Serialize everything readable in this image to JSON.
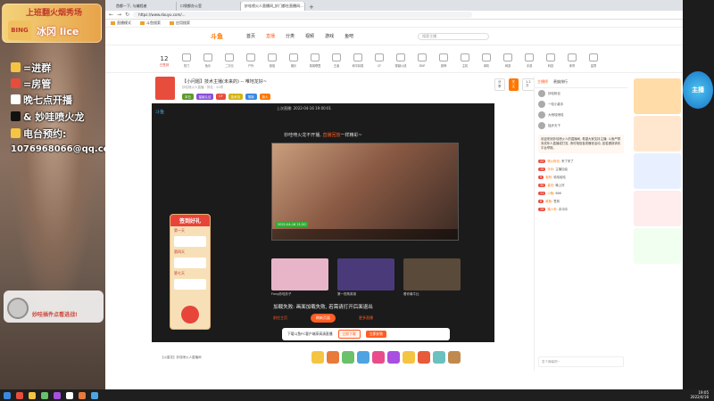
{
  "overlay": {
    "badge_title": "上班翻火烟秀场",
    "badge_name": "冰冈 lice",
    "badge_avatar": "BING",
    "lines": [
      "=进群",
      "=房管",
      "晚七点开播",
      "& 妙哇喷火龙",
      "电台预约:",
      "1076968066@qq.com"
    ],
    "bottom_text": "妙哇插件点看进战!"
  },
  "browser": {
    "tabs": [
      "首都—下, 与编程者",
      "口袋都办公室",
      "妙哇喷火人直播间_妙门都在直播间..."
    ],
    "url": "https://www.douyu.com/...",
    "bookmarks": [
      "直播模式",
      "斗鱼搜索",
      "应用搜索"
    ]
  },
  "site": {
    "logo": "斗鱼",
    "nav": [
      "首页",
      "直播",
      "分类",
      "视频",
      "游戏",
      "鱼吧"
    ],
    "search_placeholder": "搜索主播",
    "day_num": "12",
    "day_label": "已签到",
    "categories": [
      "热门",
      "鱼乐",
      "二次元",
      "户外",
      "颜值",
      "娱乐",
      "英雄联盟",
      "王者",
      "和平精英",
      "CF",
      "穿越火线",
      "DNF",
      "原神",
      "主机",
      "单机",
      "网游",
      "手游",
      "科技",
      "体育",
      "星秀"
    ]
  },
  "room": {
    "title": "【小问题】技术主播(未来的) -- 唯地龙好~",
    "sub": "妙哇喷火人直播 · 排名 · 20项",
    "tags": [
      "本日",
      "星级认证",
      "CF",
      "技术流",
      "带妹",
      "新人"
    ],
    "tag_colors": [
      "#5c9a2c",
      "#8a4fd8",
      "#e84c3d",
      "#d2b40f",
      "#3a88e0",
      "#ff7700"
    ],
    "btn_share": "分享",
    "btn_follow": "关注",
    "follow_count": "1.2万"
  },
  "player": {
    "top": "上次直播: 2022-04-16 19:00:01",
    "logo_text": "斗鱼",
    "tip_before": "妙哇喷火龙不开播, ",
    "tip_em": "直播回放",
    "tip_after": "一样精彩~",
    "video_date": "2022-04-16 21:20",
    "thumbs": [
      "Fong妙哇妙子",
      "第一视角英雄",
      "看你最牛比"
    ],
    "thumb_colors": [
      "#e8b4c8",
      "#4a3a7a",
      "#5a4a3a"
    ],
    "load_text": "加载失败: 画面加载失败, 若需请打开后面退出",
    "btn_home": "前往主页",
    "btn_reload": "刷新页面",
    "btn_other": "更多直播",
    "dl_text": "下载斗鱼PC客户端享高清直播",
    "dl_btn1": "立即下载",
    "dl_btn2": "立即安装"
  },
  "checkin": {
    "title": "签到好礼",
    "days": [
      "第一天",
      "第四天",
      "第七天"
    ]
  },
  "giftbar": {
    "label": "【火星花】妙哇喷火人直播间",
    "colors": [
      "#f4c542",
      "#e87a3a",
      "#6bc06b",
      "#4fa3e0",
      "#e84c8a",
      "#a84fe0",
      "#f4c542",
      "#e85a3a",
      "#6bc0c0",
      "#c08a4f"
    ]
  },
  "chat": {
    "tabs": [
      "主播榜",
      "贵族排行"
    ],
    "ranks": [
      "妙哇粉丝",
      "一哇小能手",
      "大喷哇喷哇",
      "独步天下"
    ],
    "notice": "欢迎来到妙哇喷火人的直播间, 希望大家支持主播; 斗鱼严禁未成年人直播或打赏, 请勿相信各类赚钱活动, 如若遇到请向平台举报。",
    "msgs": [
      {
        "lv": "22",
        "user": "喷火粉丝",
        "text": "来了来了"
      },
      {
        "lv": "15",
        "user": "乐乐",
        "text": "主播加油"
      },
      {
        "lv": "9",
        "user": "老粉",
        "text": "哈哈哈哈"
      },
      {
        "lv": "30",
        "user": "星光",
        "text": "晚上好"
      },
      {
        "lv": "11",
        "user": "小鱼",
        "text": "666"
      },
      {
        "lv": "6",
        "user": "咸鱼",
        "text": "签到"
      },
      {
        "lv": "19",
        "user": "路人甲",
        "text": "冲冲冲"
      }
    ],
    "input_placeholder": "发个弹幕吧~"
  },
  "side": {
    "ad_colors": [
      "#ffdca8",
      "#ffe7cf",
      "#e8f0ff",
      "#ffecec",
      "#f0fff0"
    ]
  },
  "taskbar": {
    "time": "19:05",
    "date": "2022/4/16",
    "icon_colors": [
      "#3a88e0",
      "#e84c3d",
      "#f4c542",
      "#6bc06b",
      "#a84fe0",
      "#ffffff",
      "#e87a3a",
      "#4fa3e0"
    ]
  },
  "right_badge": "主播"
}
